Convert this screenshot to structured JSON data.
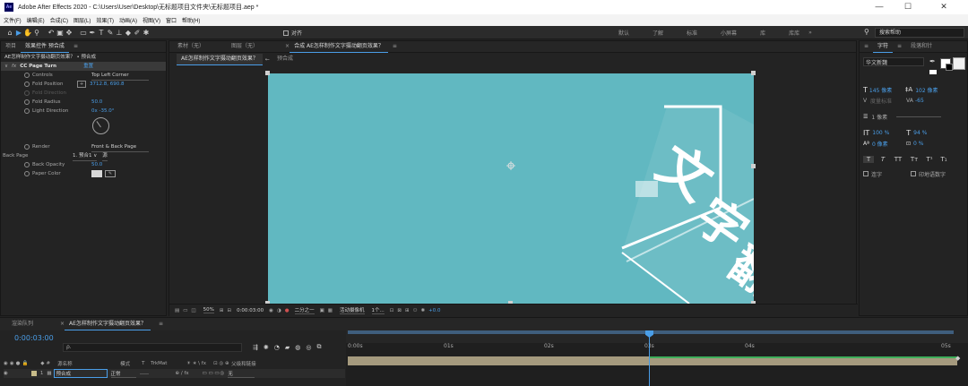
{
  "titlebar": {
    "logo": "Ae",
    "title": "Adobe After Effects 2020 - C:\\Users\\User\\Desktop\\无标题项目文件夹\\无标题项目.aep *",
    "minimize": "—",
    "maximize": "☐",
    "close": "✕"
  },
  "menubar": [
    "文件(F)",
    "编辑(E)",
    "合成(C)",
    "图层(L)",
    "效果(T)",
    "动画(A)",
    "视图(V)",
    "窗口",
    "帮助(H)"
  ],
  "toolbar": {
    "snap_label": "对齐",
    "workspaces": [
      "默认",
      "了解",
      "标准",
      "小屏幕",
      "库",
      "库库"
    ],
    "active_workspace": "库库",
    "search_placeholder": "搜索帮助"
  },
  "effect_panel": {
    "tabs": [
      "项目",
      "效果控件 预合成"
    ],
    "header": "AE怎样制作文字摄动翻页效果？ • 预合成",
    "effect_name": "CC Page Turn",
    "reset_label": "重置",
    "params": {
      "controls_label": "Controls",
      "controls_value": "Top Left Corner",
      "fold_position_label": "Fold Position",
      "fold_position_value": "3712.8, 690.8",
      "fold_direction_label": "Fold Direction",
      "fold_radius_label": "Fold Radius",
      "fold_radius_value": "50.0",
      "light_direction_label": "Light Direction",
      "light_direction_value": "0x -35.0°",
      "render_label": "Render",
      "render_value": "Front & Back Page",
      "back_page_label": "Back Page",
      "back_page_value": "1. 预合1 ∨",
      "back_page_src": "源",
      "back_opacity_label": "Back Opacity",
      "back_opacity_value": "50.0",
      "paper_color_label": "Paper Color"
    }
  },
  "comp_panel": {
    "tabs": [
      "素材（无）",
      "图层（无）",
      "合成 AE怎样制作文字摄动翻页效果？"
    ],
    "breadcrumbs": [
      "AE怎样制作文字摄动翻页效果？",
      "预合成"
    ],
    "zoom": "50%",
    "timecode": "0:00:03:00",
    "resolution": "二分之一",
    "camera": "活动摄像机",
    "views": "1个...",
    "exposure": "+0.0"
  },
  "character_panel": {
    "tabs": [
      "字符",
      "段落和针"
    ],
    "font": "华文新魏",
    "font_size": "145 像素",
    "leading": "102 像素",
    "tracking_label": "度量标准",
    "tracking_value": "-65",
    "stroke": "1 像素",
    "vscale": "100 %",
    "hscale": "94 %",
    "baseline": "0 像素",
    "tsume": "0 %",
    "style_buttons": [
      "T",
      "T",
      "TT",
      "Tт",
      "T¹",
      "T₁"
    ],
    "ligature_label": "连字",
    "hindi_label": "印地语数字"
  },
  "timeline": {
    "tabs": [
      "渲染队列",
      "AE怎样制作文字摄动翻页效果？"
    ],
    "timecode": "0:00:03:00",
    "search_placeholder": "ρ.",
    "columns": [
      "源名称",
      "模式",
      "T",
      "TrkMat",
      "父级和链接"
    ],
    "layer_number": "1",
    "layer_name": "预合成",
    "layer_mode": "正常",
    "layer_parent": "无",
    "ruler": [
      "0:00s",
      "01s",
      "02s",
      "03s",
      "04s",
      "05s"
    ]
  },
  "colors": {
    "accent": "#4a9ee8",
    "comp_bg": "#61b8c1",
    "playhead": "#4a9ee8",
    "track_bar": "#a59a7e"
  },
  "icons": [
    "home-icon",
    "selection-icon",
    "hand-icon",
    "zoom-icon",
    "rotate-icon",
    "camera-icon",
    "pan-icon",
    "rect-icon",
    "pen-icon",
    "text-icon",
    "brush-icon",
    "stamp-icon",
    "eraser-icon",
    "roto-icon",
    "puppet-icon",
    "search-icon"
  ]
}
